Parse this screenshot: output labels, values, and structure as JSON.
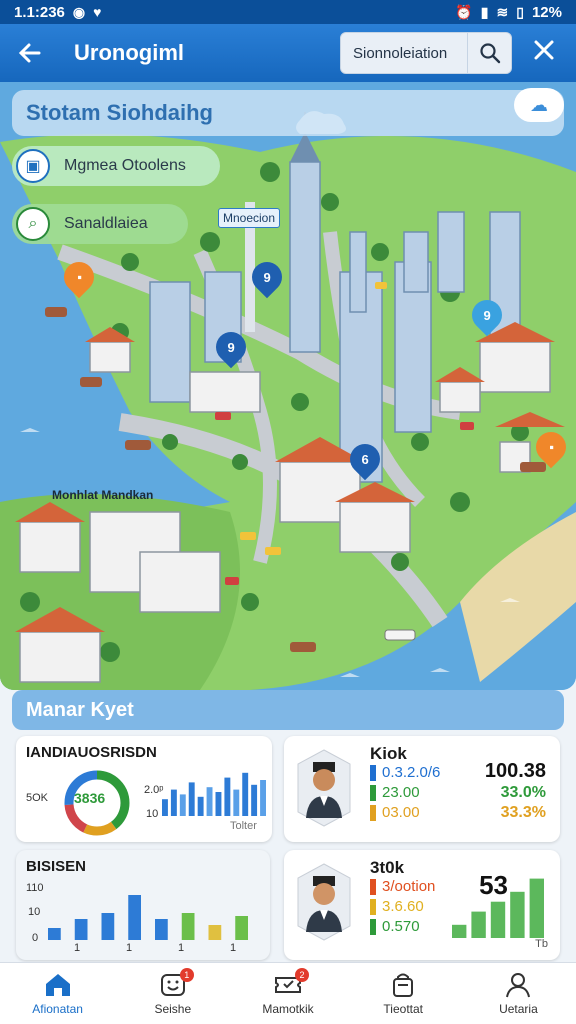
{
  "status_bar": {
    "time": "1.1:236",
    "battery": "12%"
  },
  "app_bar": {
    "title": "Uronogiml",
    "search_value": "Sionnoleiation"
  },
  "map": {
    "header": "Stotam Siohdaihg",
    "layers": [
      {
        "label": "Mgmea Otoolens"
      },
      {
        "label": "Sanaldlaiea"
      }
    ],
    "labels": {
      "tag_a": "Mnoecion",
      "tag_b": "Monhlat Mandkan"
    },
    "pins": [
      "9",
      "9",
      "6",
      "9"
    ]
  },
  "market": {
    "title": "Manar Kyet",
    "card_a": {
      "title": "IANDIAUOSRISDN",
      "donut_value": "3836",
      "donut_label": "5OK",
      "axis_top": "2.0ᵖ",
      "axis_bottom": "10",
      "caption": "Tolter",
      "bars": [
        0.35,
        0.55,
        0.45,
        0.7,
        0.4,
        0.6,
        0.5,
        0.8,
        0.55,
        0.9,
        0.65,
        0.75
      ]
    },
    "card_b": {
      "name": "Kiok",
      "rows": [
        {
          "label": "0.3.2.0/6",
          "value": "100.38",
          "color": "#1f6fd0"
        },
        {
          "label": "23.00",
          "value": "33.0%",
          "color": "#2e9a3a"
        },
        {
          "label": "03.00",
          "value": "33.3%",
          "color": "#e0a020"
        }
      ]
    },
    "card_c": {
      "title": "BISISEN",
      "y_labels": [
        "110",
        "10",
        "0"
      ],
      "x_labels": [
        "1",
        "1",
        "1",
        "1"
      ],
      "bars": [
        {
          "value": 0.2,
          "color": "#2d7bd6"
        },
        {
          "value": 0.35,
          "color": "#2d7bd6"
        },
        {
          "value": 0.45,
          "color": "#2d7bd6"
        },
        {
          "value": 0.75,
          "color": "#2d7bd6"
        },
        {
          "value": 0.35,
          "color": "#2d7bd6"
        },
        {
          "value": 0.45,
          "color": "#6bbf4a"
        },
        {
          "value": 0.25,
          "color": "#e0c040"
        },
        {
          "value": 0.4,
          "color": "#6bbf4a"
        }
      ]
    },
    "card_d": {
      "name": "3t0k",
      "rows": [
        {
          "label": "3/ootion",
          "color": "#e05020"
        },
        {
          "label": "3.6.60",
          "color": "#e0b020"
        },
        {
          "label": "0.570",
          "color": "#2e9a3a"
        }
      ],
      "big_value": "53",
      "caption": "Tb",
      "bars": [
        0.2,
        0.4,
        0.55,
        0.7,
        0.9
      ]
    }
  },
  "bottom_nav": [
    {
      "label": "Afionatan",
      "icon": "home-icon",
      "badge": ""
    },
    {
      "label": "Seishe",
      "icon": "smile-icon",
      "badge": "1"
    },
    {
      "label": "Mamotkik",
      "icon": "ticket-icon",
      "badge": "2"
    },
    {
      "label": "Tieottat",
      "icon": "bag-icon",
      "badge": ""
    },
    {
      "label": "Uetaria",
      "icon": "person-icon",
      "badge": ""
    }
  ]
}
